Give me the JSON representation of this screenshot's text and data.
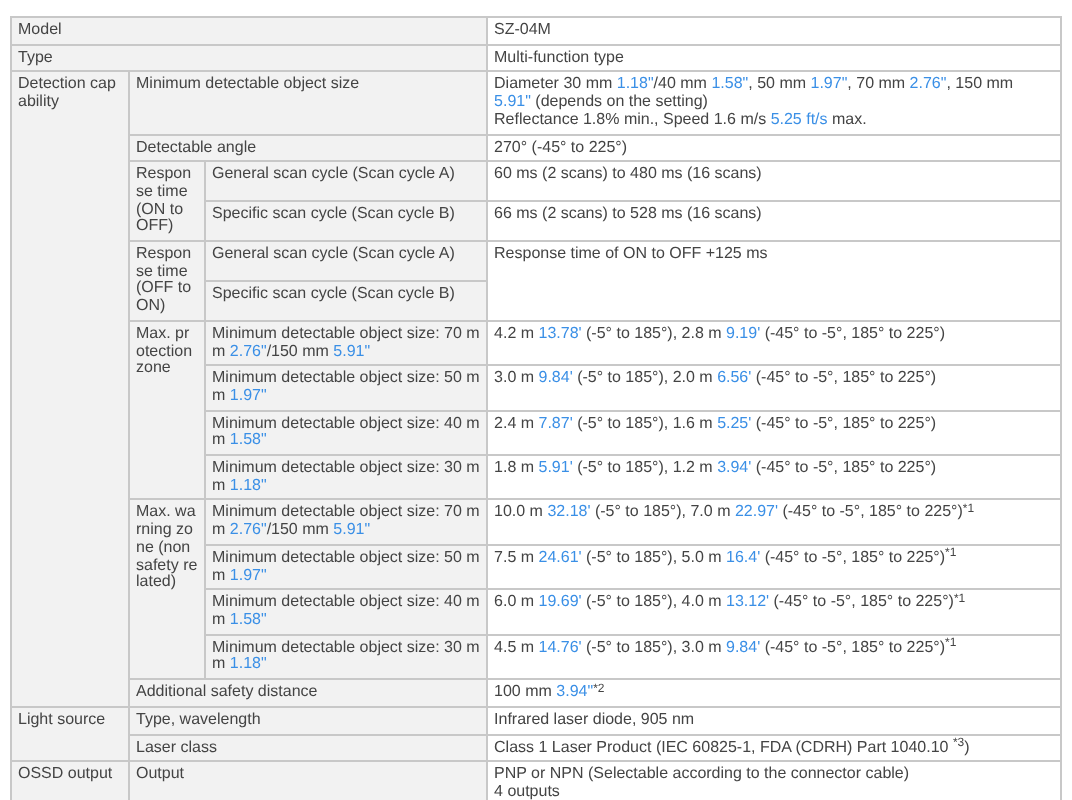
{
  "spec": [
    {
      "label": [
        {
          "text": "Model",
          "kind": "plain"
        }
      ],
      "value": [
        [
          {
            "text": "SZ-04M",
            "kind": "plain"
          }
        ]
      ]
    },
    {
      "label": [
        {
          "text": "Type",
          "kind": "plain"
        }
      ],
      "value": [
        [
          {
            "text": "Multi-function type",
            "kind": "plain"
          }
        ]
      ]
    },
    {
      "label": [
        {
          "text": "Detection capability",
          "kind": "plain"
        }
      ],
      "items": [
        {
          "label": [
            {
              "text": "Minimum detectable object size",
              "kind": "plain"
            }
          ],
          "value": [
            [
              {
                "text": "Diameter 30 mm ",
                "kind": "plain"
              },
              {
                "text": "1.18\"",
                "kind": "imperial"
              },
              {
                "text": "/40 mm ",
                "kind": "plain"
              },
              {
                "text": "1.58\"",
                "kind": "imperial"
              },
              {
                "text": ", 50 mm ",
                "kind": "plain"
              },
              {
                "text": "1.97\"",
                "kind": "imperial"
              },
              {
                "text": ", 70 mm ",
                "kind": "plain"
              },
              {
                "text": "2.76\"",
                "kind": "imperial"
              },
              {
                "text": ", 150 mm ",
                "kind": "plain"
              },
              {
                "text": "5.91\"",
                "kind": "imperial"
              },
              {
                "text": " (depends on the setting)",
                "kind": "plain"
              }
            ],
            [
              {
                "text": "Reflectance 1.8% min., Speed 1.6 m/s ",
                "kind": "plain"
              },
              {
                "text": "5.25 ft/s",
                "kind": "imperial"
              },
              {
                "text": " max.",
                "kind": "plain"
              }
            ]
          ]
        },
        {
          "label": [
            {
              "text": "Detectable angle",
              "kind": "plain"
            }
          ],
          "value": [
            [
              {
                "text": "270° (-45° to 225°)",
                "kind": "plain"
              }
            ]
          ]
        },
        {
          "label": [
            {
              "text": "Response time (ON to OFF)",
              "kind": "plain"
            }
          ],
          "items": [
            {
              "label": [
                {
                  "text": "General scan cycle (Scan cycle A)",
                  "kind": "plain"
                }
              ],
              "value": [
                [
                  {
                    "text": "60 ms (2 scans) to 480 ms (16 scans)",
                    "kind": "plain"
                  }
                ]
              ]
            },
            {
              "label": [
                {
                  "text": "Specific scan cycle (Scan cycle B)",
                  "kind": "plain"
                }
              ],
              "value": [
                [
                  {
                    "text": "66 ms (2 scans) to 528 ms (16 scans)",
                    "kind": "plain"
                  }
                ]
              ]
            }
          ]
        },
        {
          "label": [
            {
              "text": "Response time (OFF to ON)",
              "kind": "plain"
            }
          ],
          "items": [
            {
              "label": [
                {
                  "text": "General scan cycle (Scan cycle A)",
                  "kind": "plain"
                }
              ],
              "value": [
                [
                  {
                    "text": "Response time of ON to OFF +125 ms",
                    "kind": "plain"
                  }
                ]
              ]
            },
            {
              "label": [
                {
                  "text": "Specific scan cycle (Scan cycle B)",
                  "kind": "plain"
                }
              ]
            }
          ]
        },
        {
          "label": [
            {
              "text": "Max. protection zone",
              "kind": "plain"
            }
          ],
          "items": [
            {
              "label": [
                {
                  "text": "Minimum detectable object size: 70 mm ",
                  "kind": "plain"
                },
                {
                  "text": "2.76\"",
                  "kind": "imperial"
                },
                {
                  "text": "/150 mm ",
                  "kind": "plain"
                },
                {
                  "text": "5.91\"",
                  "kind": "imperial"
                }
              ],
              "value": [
                [
                  {
                    "text": "4.2 m ",
                    "kind": "plain"
                  },
                  {
                    "text": "13.78'",
                    "kind": "imperial"
                  },
                  {
                    "text": " (-5° to 185°), 2.8 m ",
                    "kind": "plain"
                  },
                  {
                    "text": "9.19'",
                    "kind": "imperial"
                  },
                  {
                    "text": " (-45° to -5°, 185° to 225°)",
                    "kind": "plain"
                  }
                ]
              ]
            },
            {
              "label": [
                {
                  "text": "Minimum detectable object size: 50 mm ",
                  "kind": "plain"
                },
                {
                  "text": "1.97\"",
                  "kind": "imperial"
                }
              ],
              "value": [
                [
                  {
                    "text": "3.0 m ",
                    "kind": "plain"
                  },
                  {
                    "text": "9.84'",
                    "kind": "imperial"
                  },
                  {
                    "text": " (-5° to 185°), 2.0 m ",
                    "kind": "plain"
                  },
                  {
                    "text": "6.56'",
                    "kind": "imperial"
                  },
                  {
                    "text": " (-45° to -5°, 185° to 225°)",
                    "kind": "plain"
                  }
                ]
              ]
            },
            {
              "label": [
                {
                  "text": "Minimum detectable object size: 40 mm ",
                  "kind": "plain"
                },
                {
                  "text": "1.58\"",
                  "kind": "imperial"
                }
              ],
              "value": [
                [
                  {
                    "text": "2.4 m ",
                    "kind": "plain"
                  },
                  {
                    "text": "7.87'",
                    "kind": "imperial"
                  },
                  {
                    "text": " (-5° to 185°), 1.6 m ",
                    "kind": "plain"
                  },
                  {
                    "text": "5.25'",
                    "kind": "imperial"
                  },
                  {
                    "text": " (-45° to -5°, 185° to 225°)",
                    "kind": "plain"
                  }
                ]
              ]
            },
            {
              "label": [
                {
                  "text": "Minimum detectable object size: 30 mm ",
                  "kind": "plain"
                },
                {
                  "text": "1.18\"",
                  "kind": "imperial"
                }
              ],
              "value": [
                [
                  {
                    "text": "1.8 m ",
                    "kind": "plain"
                  },
                  {
                    "text": "5.91'",
                    "kind": "imperial"
                  },
                  {
                    "text": " (-5° to 185°), 1.2 m ",
                    "kind": "plain"
                  },
                  {
                    "text": "3.94'",
                    "kind": "imperial"
                  },
                  {
                    "text": " (-45° to -5°, 185° to 225°)",
                    "kind": "plain"
                  }
                ]
              ]
            }
          ]
        },
        {
          "label": [
            {
              "text": "Max. warning zone (non safety related)",
              "kind": "plain"
            }
          ],
          "items": [
            {
              "label": [
                {
                  "text": "Minimum detectable object size: 70 mm ",
                  "kind": "plain"
                },
                {
                  "text": "2.76\"",
                  "kind": "imperial"
                },
                {
                  "text": "/150 mm ",
                  "kind": "plain"
                },
                {
                  "text": "5.91\"",
                  "kind": "imperial"
                }
              ],
              "value": [
                [
                  {
                    "text": "10.0 m ",
                    "kind": "plain"
                  },
                  {
                    "text": "32.18'",
                    "kind": "imperial"
                  },
                  {
                    "text": " (-5° to 185°), 7.0 m ",
                    "kind": "plain"
                  },
                  {
                    "text": "22.97'",
                    "kind": "imperial"
                  },
                  {
                    "text": " (-45° to -5°, 185° to 225°)$^{*1}$",
                    "kind": "plain"
                  }
                ]
              ]
            },
            {
              "label": [
                {
                  "text": "Minimum detectable object size: 50 mm ",
                  "kind": "plain"
                },
                {
                  "text": "1.97\"",
                  "kind": "imperial"
                }
              ],
              "value": [
                [
                  {
                    "text": "7.5 m ",
                    "kind": "plain"
                  },
                  {
                    "text": "24.61'",
                    "kind": "imperial"
                  },
                  {
                    "text": " (-5° to 185°), 5.0 m ",
                    "kind": "plain"
                  },
                  {
                    "text": "16.4'",
                    "kind": "imperial"
                  },
                  {
                    "text": " (-45° to -5°, 185° to 225°)$^{*1}$",
                    "kind": "plain"
                  }
                ]
              ]
            },
            {
              "label": [
                {
                  "text": "Minimum detectable object size: 40 mm ",
                  "kind": "plain"
                },
                {
                  "text": "1.58\"",
                  "kind": "imperial"
                }
              ],
              "value": [
                [
                  {
                    "text": "6.0 m ",
                    "kind": "plain"
                  },
                  {
                    "text": "19.69'",
                    "kind": "imperial"
                  },
                  {
                    "text": " (-5° to 185°), 4.0 m ",
                    "kind": "plain"
                  },
                  {
                    "text": "13.12'",
                    "kind": "imperial"
                  },
                  {
                    "text": " (-45° to -5°, 185° to 225°)$^{*1}$",
                    "kind": "plain"
                  }
                ]
              ]
            },
            {
              "label": [
                {
                  "text": "Minimum detectable object size: 30 mm ",
                  "kind": "plain"
                },
                {
                  "text": "1.18\"",
                  "kind": "imperial"
                }
              ],
              "value": [
                [
                  {
                    "text": "4.5 m ",
                    "kind": "plain"
                  },
                  {
                    "text": "14.76'",
                    "kind": "imperial"
                  },
                  {
                    "text": " (-5° to 185°), 3.0 m ",
                    "kind": "plain"
                  },
                  {
                    "text": "9.84'",
                    "kind": "imperial"
                  },
                  {
                    "text": " (-45° to -5°, 185° to 225°)$^{*1}$",
                    "kind": "plain"
                  }
                ]
              ]
            }
          ]
        },
        {
          "label": [
            {
              "text": "Additional safety distance",
              "kind": "plain"
            }
          ],
          "value": [
            [
              {
                "text": "100 mm ",
                "kind": "plain"
              },
              {
                "text": "3.94\"",
                "kind": "imperial"
              },
              {
                "text": "$^{*2}$",
                "kind": "plain"
              }
            ]
          ]
        }
      ]
    },
    {
      "label": [
        {
          "text": "Light source",
          "kind": "plain"
        }
      ],
      "items": [
        {
          "label": [
            {
              "text": "Type, wavelength",
              "kind": "plain"
            }
          ],
          "value": [
            [
              {
                "text": "Infrared laser diode, 905 nm",
                "kind": "plain"
              }
            ]
          ]
        },
        {
          "label": [
            {
              "text": "Laser class",
              "kind": "plain"
            }
          ],
          "value": [
            [
              {
                "text": "Class 1 Laser Product (IEC 60825-1, FDA (CDRH) Part 1040.10 $^{*3}$)",
                "kind": "plain"
              }
            ]
          ]
        }
      ]
    },
    {
      "label": [
        {
          "text": "OSSD output",
          "kind": "plain"
        }
      ],
      "items": [
        {
          "label": [
            {
              "text": "Output",
              "kind": "plain"
            }
          ],
          "value": [
            [
              {
                "text": "PNP or NPN (Selectable according to the connector cable)",
                "kind": "plain"
              }
            ],
            [
              {
                "text": "4 outputs",
                "kind": "plain"
              }
            ]
          ]
        }
      ]
    }
  ]
}
